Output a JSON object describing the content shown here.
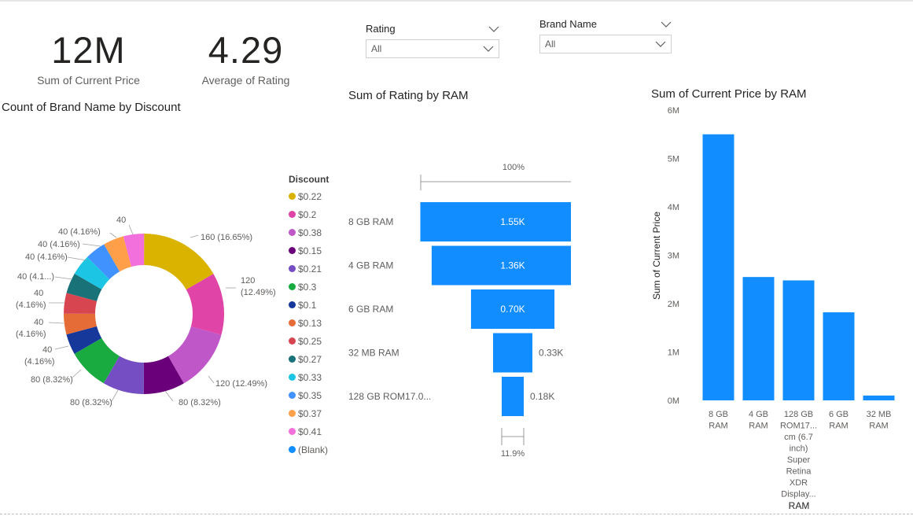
{
  "kpi": {
    "price_value": "12M",
    "price_label": "Sum of Current Price",
    "rating_value": "4.29",
    "rating_label": "Average of Rating"
  },
  "slicers": {
    "rating": {
      "label": "Rating",
      "value": "All"
    },
    "brand": {
      "label": "Brand Name",
      "value": "All"
    }
  },
  "donut": {
    "title": "Count of Brand Name by Discount",
    "legend_title": "Discount",
    "legend": [
      {
        "label": "$0.22",
        "color": "#D9B300"
      },
      {
        "label": "$0.2",
        "color": "#E044A7"
      },
      {
        "label": "$0.38",
        "color": "#C057C9"
      },
      {
        "label": "$0.15",
        "color": "#6B007B"
      },
      {
        "label": "$0.21",
        "color": "#744EC2"
      },
      {
        "label": "$0.3",
        "color": "#1AAB40"
      },
      {
        "label": "$0.1",
        "color": "#15389A"
      },
      {
        "label": "$0.13",
        "color": "#E66C37"
      },
      {
        "label": "$0.25",
        "color": "#D64550"
      },
      {
        "label": "$0.27",
        "color": "#197278"
      },
      {
        "label": "$0.33",
        "color": "#1BC5E3"
      },
      {
        "label": "$0.35",
        "color": "#4092FF"
      },
      {
        "label": "$0.37",
        "color": "#FF9F4A"
      },
      {
        "label": "$0.41",
        "color": "#F170DB"
      },
      {
        "label": "(Blank)",
        "color": "#118DFF"
      }
    ],
    "labels": {
      "l0": "160 (16.65%)",
      "l1a": "120",
      "l1b": "(12.49%)",
      "l2": "120 (12.49%)",
      "l3": "80 (8.32%)",
      "l4": "80 (8.32%)",
      "l5": "80 (8.32%)",
      "l6a": "40",
      "l6b": "(4.16%)",
      "l7a": "40",
      "l7b": "(4.16%)",
      "l8a": "40",
      "l8b": "(4.16%)",
      "l9": "40 (4.1...)",
      "l10": "40 (4.16%)",
      "l11": "40 (4.16%)",
      "l12": "40 (4.16%)",
      "l13": "40"
    }
  },
  "funnel": {
    "title": "Sum of Rating by RAM",
    "top_pct": "100%",
    "bottom_pct": "11.9%"
  },
  "bar": {
    "title": "Sum of Current Price by RAM",
    "ylabel": "Sum of Current Price",
    "xlabel": "RAM",
    "ticks": [
      "0M",
      "1M",
      "2M",
      "3M",
      "4M",
      "5M",
      "6M"
    ],
    "cat_lines": [
      [
        "8 GB",
        "RAM"
      ],
      [
        "4 GB",
        "RAM"
      ],
      [
        "128 GB",
        "ROM17...",
        "cm (6.7",
        "inch)",
        "Super",
        "Retina",
        "XDR",
        "Display..."
      ],
      [
        "6 GB",
        "RAM"
      ],
      [
        "32 MB",
        "RAM"
      ]
    ]
  },
  "chart_data": [
    {
      "type": "pie",
      "title": "Count of Brand Name by Discount",
      "categories": [
        "$0.22",
        "$0.2",
        "$0.38",
        "$0.15",
        "$0.21",
        "$0.3",
        "$0.1",
        "$0.13",
        "$0.25",
        "$0.27",
        "$0.33",
        "$0.35",
        "$0.37",
        "$0.41"
      ],
      "values": [
        160,
        120,
        120,
        80,
        80,
        80,
        40,
        40,
        40,
        40,
        40,
        40,
        40,
        40
      ],
      "legend": "left"
    },
    {
      "type": "bar",
      "subtype": "funnel",
      "title": "Sum of Rating by RAM",
      "categories": [
        "8 GB RAM",
        "4 GB RAM",
        "6 GB RAM",
        "32 MB RAM",
        "128 GB ROM17.0..."
      ],
      "values": [
        1550,
        1360,
        700,
        330,
        180
      ],
      "data_labels": [
        "1.55K",
        "1.36K",
        "0.70K",
        "0.33K",
        "0.18K"
      ]
    },
    {
      "type": "bar",
      "title": "Sum of Current Price by RAM",
      "categories": [
        "8 GB RAM",
        "4 GB RAM",
        "128 GB ROM17... cm (6.7 inch) Super Retina XDR Display...",
        "6 GB RAM",
        "32 MB RAM"
      ],
      "values": [
        5500000,
        2550000,
        2480000,
        1820000,
        100000
      ],
      "xlabel": "RAM",
      "ylabel": "Sum of Current Price",
      "ylim": [
        0,
        6000000
      ],
      "grid": false
    }
  ]
}
